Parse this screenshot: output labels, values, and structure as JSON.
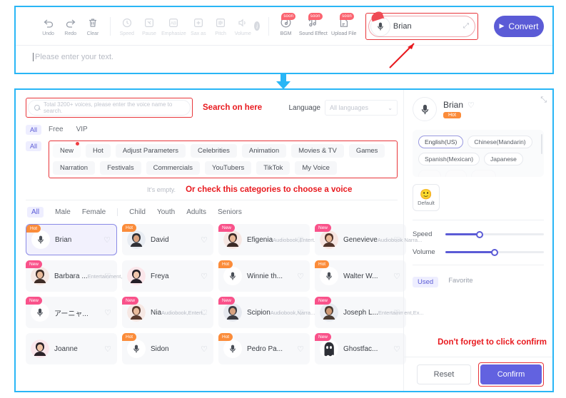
{
  "editor": {
    "toolbar": [
      {
        "label": "Undo",
        "icon": "undo-icon",
        "state": "enabled"
      },
      {
        "label": "Redo",
        "icon": "redo-icon",
        "state": "enabled"
      },
      {
        "label": "Clear",
        "icon": "trash-icon",
        "state": "enabled"
      },
      {
        "label": "Speed",
        "icon": "speed-icon",
        "state": "disabled"
      },
      {
        "label": "Pause",
        "icon": "pause-icon",
        "state": "disabled"
      },
      {
        "label": "Emphasize",
        "icon": "emphasize-icon",
        "state": "disabled"
      },
      {
        "label": "Sax as",
        "icon": "sax-as-icon",
        "state": "disabled"
      },
      {
        "label": "Pitch",
        "icon": "pitch-icon",
        "state": "disabled"
      },
      {
        "label": "Volume",
        "icon": "volume-icon",
        "state": "disabled"
      }
    ],
    "soon_tools": [
      {
        "label": "BGM",
        "icon": "bgm-icon",
        "badge": "soon"
      },
      {
        "label": "Sound Effect",
        "icon": "sound-effect-icon",
        "badge": "soon"
      },
      {
        "label": "Upload File",
        "icon": "upload-file-icon",
        "badge": "soon"
      }
    ],
    "voice_chip": {
      "name": "Brian",
      "avatar": "microphone-santa"
    },
    "convert_label": "Convert",
    "text_placeholder": "Please enter your text."
  },
  "picker": {
    "search_placeholder": "Total 3200+ voices, please enter the voice name to search.",
    "language_label": "Language",
    "language_value": "All languages",
    "plan_tabs": [
      "All",
      "Free",
      "VIP"
    ],
    "plan_selected": "All",
    "categories_all_label": "All",
    "categories": [
      "New",
      "Hot",
      "Adjust Parameters",
      "Celebrities",
      "Animation",
      "Movies & TV",
      "Games",
      "Narration",
      "Festivals",
      "Commercials",
      "YouTubers",
      "TikTok",
      "My Voice"
    ],
    "empty_text": "It's empty.",
    "gender_tabs": [
      "All",
      "Male",
      "Female"
    ],
    "age_tabs": [
      "Child",
      "Youth",
      "Adults",
      "Seniors"
    ],
    "gender_selected": "All",
    "voices": [
      {
        "name": "Brian",
        "tag": "",
        "badge": "Hot",
        "avatar": "microphone",
        "selected": true
      },
      {
        "name": "David",
        "tag": "",
        "badge": "Hot",
        "avatar": "man-1"
      },
      {
        "name": "Efigenia",
        "tag": "Audiobook,Entert...",
        "badge": "New",
        "avatar": "woman-1"
      },
      {
        "name": "Genevieve",
        "tag": "Audiobook,Narra...",
        "badge": "New",
        "avatar": "woman-2"
      },
      {
        "name": "Barbara ...",
        "tag": "Entertainment,Ex...",
        "badge": "New",
        "avatar": "woman-3"
      },
      {
        "name": "Freya",
        "tag": "",
        "badge": "",
        "avatar": "woman-4"
      },
      {
        "name": "Winnie th...",
        "tag": "",
        "badge": "Hot",
        "avatar": "microphone"
      },
      {
        "name": "Walter W...",
        "tag": "",
        "badge": "Hot",
        "avatar": "microphone"
      },
      {
        "name": "アーニャ...",
        "tag": "",
        "badge": "New",
        "avatar": "microphone"
      },
      {
        "name": "Nia",
        "tag": "Audiobook,Entert...",
        "badge": "New",
        "avatar": "woman-5"
      },
      {
        "name": "Scipion",
        "tag": "Audiobook,Narra...",
        "badge": "New",
        "avatar": "man-2"
      },
      {
        "name": "Joseph L...",
        "tag": "Entertainment,Ex...",
        "badge": "New",
        "avatar": "man-3"
      },
      {
        "name": "Joanne",
        "tag": "",
        "badge": "",
        "avatar": "woman-6"
      },
      {
        "name": "Sidon",
        "tag": "",
        "badge": "Hot",
        "avatar": "microphone"
      },
      {
        "name": "Pedro Pa...",
        "tag": "",
        "badge": "Hot",
        "avatar": "microphone"
      },
      {
        "name": "Ghostfac...",
        "tag": "",
        "badge": "New",
        "avatar": "ghost"
      }
    ]
  },
  "detail": {
    "name": "Brian",
    "badge": "Hot",
    "languages": [
      "English(US)",
      "Chinese(Mandarin)",
      "Spanish(Mexican)",
      "Japanese"
    ],
    "language_selected": "English(US)",
    "emotion_label": "Default",
    "emotion_face": "🙂",
    "speed_label": "Speed",
    "speed_value": 35,
    "volume_label": "Volume",
    "volume_value": 50,
    "list_tabs": [
      "Used",
      "Favorite"
    ],
    "list_tab_selected": "Used",
    "reset_label": "Reset",
    "confirm_label": "Confirm"
  },
  "annotations": {
    "search": "Search on here",
    "categories": "Or check this categories to choose a voice",
    "confirm": "Don't forget to click confirm",
    "color": "#e8191e"
  }
}
